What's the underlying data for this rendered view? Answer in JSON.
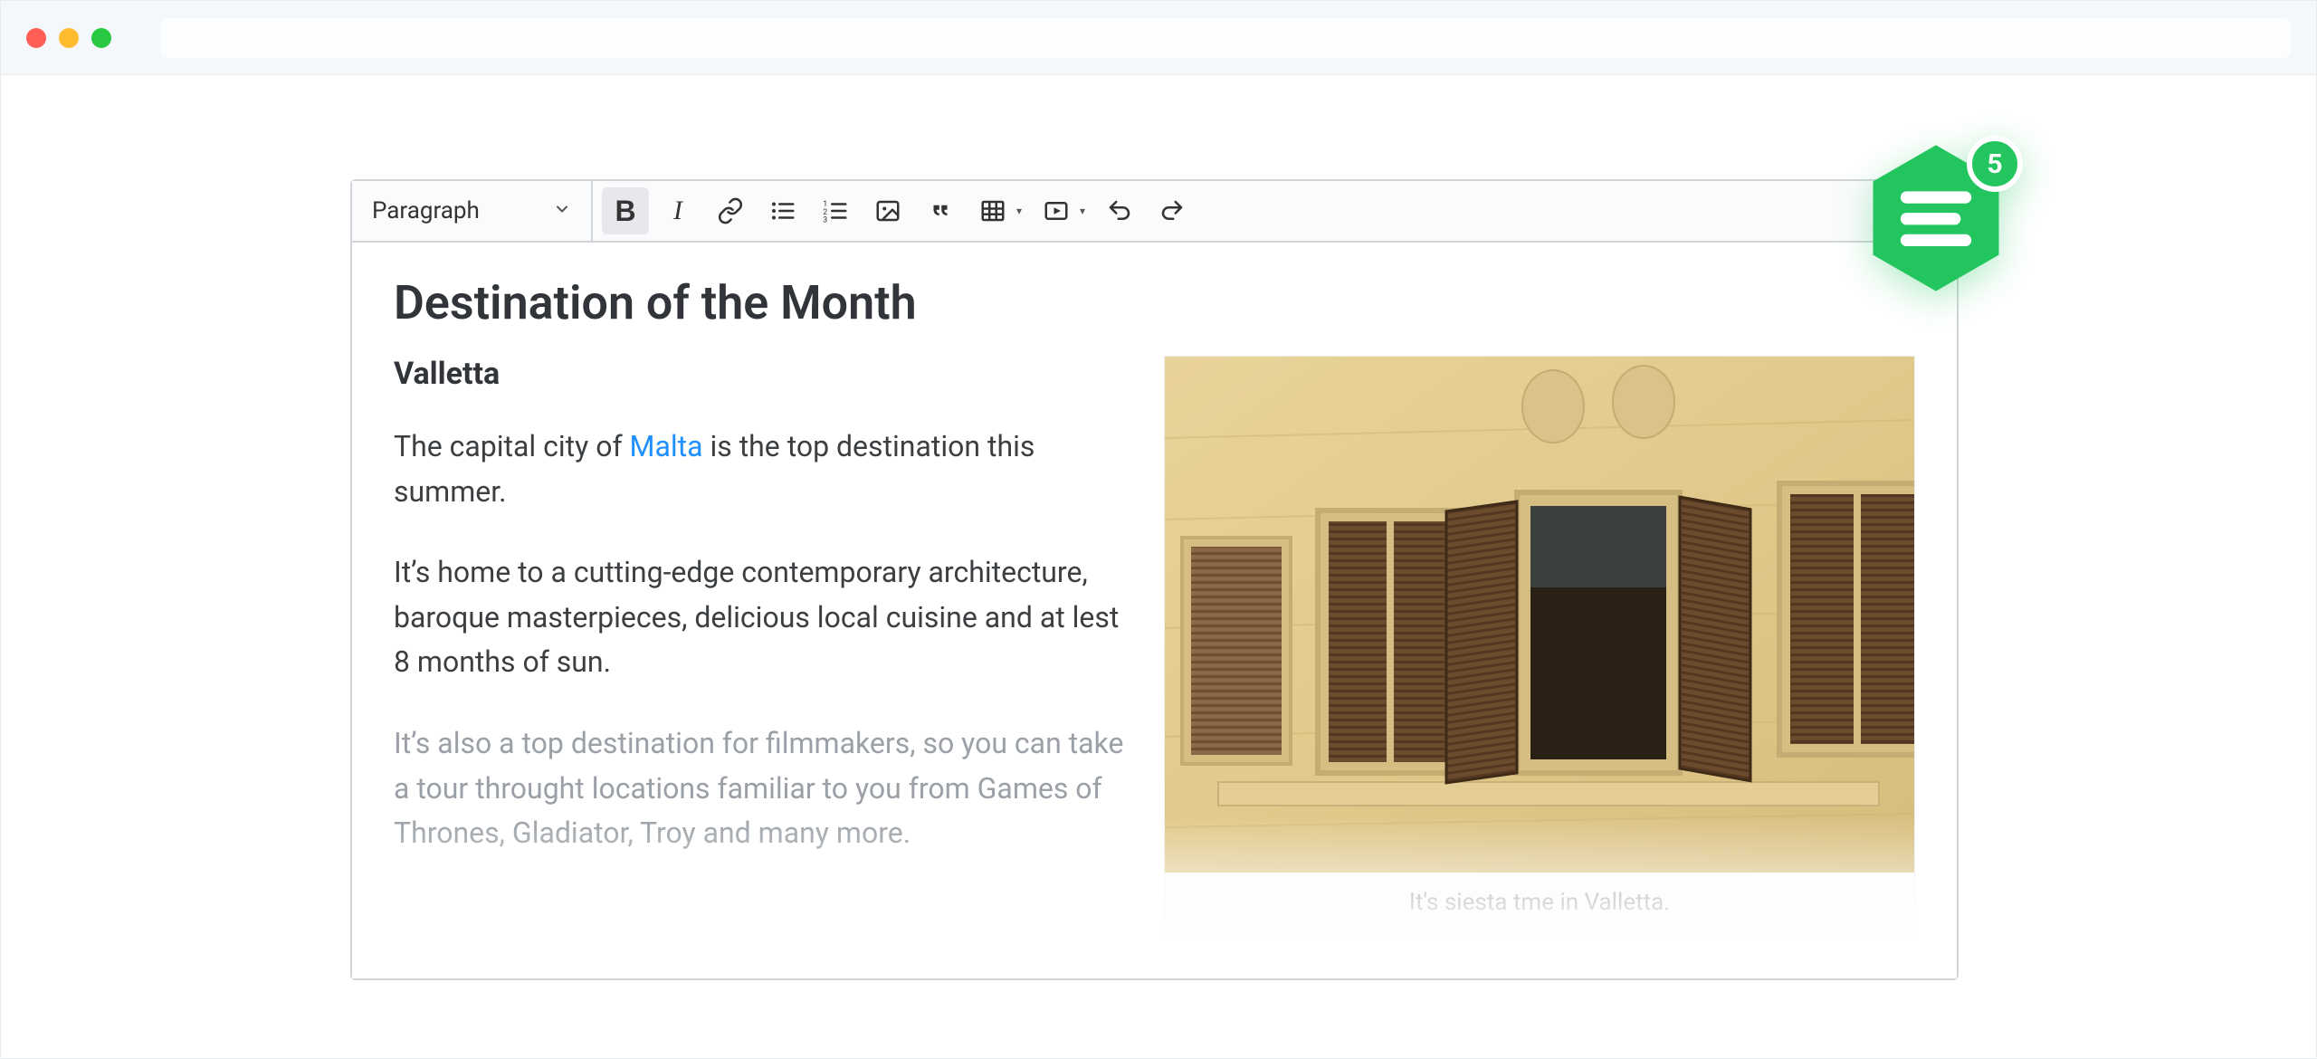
{
  "toolbar": {
    "style_label": "Paragraph",
    "buttons": {
      "bold": {
        "name": "bold-button",
        "active": true
      },
      "italic": {
        "name": "italic-button",
        "active": false
      },
      "link": {
        "name": "link-button"
      },
      "ul": {
        "name": "unordered-list-button"
      },
      "ol": {
        "name": "ordered-list-button"
      },
      "image": {
        "name": "image-button"
      },
      "quote": {
        "name": "blockquote-button"
      },
      "table": {
        "name": "table-button",
        "has_dropdown": true
      },
      "media": {
        "name": "media-button",
        "has_dropdown": true
      },
      "undo": {
        "name": "undo-button"
      },
      "redo": {
        "name": "redo-button"
      }
    }
  },
  "document": {
    "title": "Destination of the Month",
    "subtitle": "Valletta",
    "p1_prefix": "The capital city of ",
    "p1_link_text": "Malta",
    "p1_suffix": " is the top destination this summer.",
    "p2": "It’s home to a cutting-edge contemporary architecture, baroque masterpieces, delicious local cuisine and at lest 8 months of sun.",
    "p3": "It’s also a top destination for filmmakers, so you can take a tour throught locations familiar to you from Games of Thrones, Gladiator, Troy and many more.",
    "figure_caption": "It's siesta tme in Valletta."
  },
  "badge": {
    "count": "5",
    "color": "#22c55e"
  }
}
